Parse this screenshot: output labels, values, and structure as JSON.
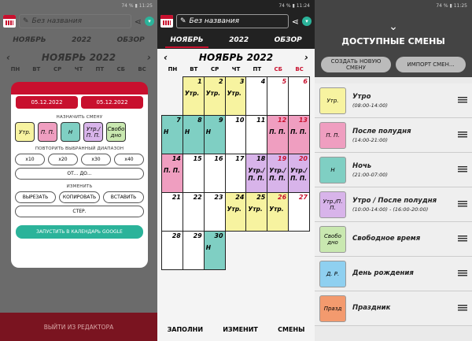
{
  "status": {
    "p1": "74 % ▮ 11:25",
    "p2": "74 % ▮ 11:24",
    "p3": "74 % ▮ 11:25"
  },
  "app": {
    "title": "Без названия"
  },
  "tabs": [
    "НОЯБРЬ",
    "2022",
    "ОБЗОР"
  ],
  "month_title": "НОЯБРЬ 2022",
  "weekdays": [
    "ПН",
    "ВТ",
    "СР",
    "ЧТ",
    "ПТ",
    "СБ",
    "ВС"
  ],
  "calendar": [
    {
      "d": "",
      "l": ""
    },
    {
      "d": "1",
      "l": "Утр."
    },
    {
      "d": "2",
      "l": "Утр."
    },
    {
      "d": "3",
      "l": "Утр."
    },
    {
      "d": "4",
      "l": ""
    },
    {
      "d": "5",
      "l": ""
    },
    {
      "d": "6",
      "l": ""
    },
    {
      "d": "7",
      "l": "Н"
    },
    {
      "d": "8",
      "l": "Н"
    },
    {
      "d": "9",
      "l": "Н"
    },
    {
      "d": "10",
      "l": ""
    },
    {
      "d": "11",
      "l": ""
    },
    {
      "d": "12",
      "l": "П. П."
    },
    {
      "d": "13",
      "l": "П. П."
    },
    {
      "d": "14",
      "l": "П. П."
    },
    {
      "d": "15",
      "l": ""
    },
    {
      "d": "16",
      "l": ""
    },
    {
      "d": "17",
      "l": ""
    },
    {
      "d": "18",
      "l": "Утр./ П. П."
    },
    {
      "d": "19",
      "l": "Утр./ П. П."
    },
    {
      "d": "20",
      "l": "Утр./ П. П."
    },
    {
      "d": "21",
      "l": ""
    },
    {
      "d": "22",
      "l": ""
    },
    {
      "d": "23",
      "l": ""
    },
    {
      "d": "24",
      "l": "Утр."
    },
    {
      "d": "25",
      "l": "Утр."
    },
    {
      "d": "26",
      "l": "Утр."
    },
    {
      "d": "27",
      "l": ""
    },
    {
      "d": "28",
      "l": ""
    },
    {
      "d": "29",
      "l": ""
    },
    {
      "d": "30",
      "l": "Н"
    },
    {
      "d": "",
      "l": ""
    },
    {
      "d": "",
      "l": ""
    },
    {
      "d": "",
      "l": ""
    },
    {
      "d": "",
      "l": ""
    }
  ],
  "calendar_colors": [
    "",
    "#f7f3a0",
    "#f7f3a0",
    "#f7f3a0",
    "",
    "",
    "",
    "#7fcfc3",
    "#7fcfc3",
    "#7fcfc3",
    "",
    "",
    "#ef9ec0",
    "#ef9ec0",
    "#ef9ec0",
    "",
    "",
    "",
    "#d8b4ea",
    "#d8b4ea",
    "#d8b4ea",
    "",
    "",
    "",
    "#f7f3a0",
    "#f7f3a0",
    "#f7f3a0",
    "",
    "",
    "",
    "#7fcfc3",
    "",
    "",
    "",
    "",
    ""
  ],
  "dialog": {
    "from_label": "ОТ",
    "to_label": "ДО",
    "from_date": "05.12.2022",
    "to_date": "05.12.2022",
    "assign_label": "НАЗНАЧИТЬ СМЕНУ",
    "chips": [
      {
        "t": "Утр.",
        "c": "#f7f3a0"
      },
      {
        "t": "П. П.",
        "c": "#ef9ec0"
      },
      {
        "t": "Н",
        "c": "#7fcfc3"
      },
      {
        "t": "Утр./ П. П.",
        "c": "#d8b4ea"
      },
      {
        "t": "Свобо дно",
        "c": "#c9e8b0"
      }
    ],
    "repeat_label": "ПОВТОРИТЬ ВЫБРАННЫЙ ДИАПАЗОН",
    "repeat": [
      "x10",
      "x20",
      "x30",
      "x40"
    ],
    "until": "ОТ... ДО...",
    "change_label": "ИЗМЕНИТЬ",
    "edit": [
      "ВЫРЕЗАТЬ",
      "КОПИРОВАТЬ",
      "ВСТАВИТЬ"
    ],
    "clear": "СТЕР.",
    "google": "ЗАПУСТИТЬ В КАЛЕНДАРЬ GOOGLE"
  },
  "exit": "ВЫЙТИ ИЗ РЕДАКТОРА",
  "bottom": [
    "ЗАПОЛНИ",
    "ИЗМЕНИТ",
    "СМЕНЫ"
  ],
  "shifts_panel": {
    "title": "ДОСТУПНЫЕ СМЕНЫ",
    "create": "СОЗДАТЬ НОВУЮ СМЕНУ",
    "import": "ИМПОРТ СМЕН..."
  },
  "shifts": [
    {
      "abbr": "Утр.",
      "name": "Утро",
      "time": "(08:00-14:00)",
      "color": "#f7f3a0"
    },
    {
      "abbr": "П. П.",
      "name": "После полудня",
      "time": "(14:00-21:00)",
      "color": "#ef9ec0"
    },
    {
      "abbr": "Н",
      "name": "Ночь",
      "time": "(21:00-07:00)",
      "color": "#7fcfc3"
    },
    {
      "abbr": "Утр./П. П.",
      "name": "Утро / После полудня",
      "time": "(10:00-14:00) - (16:00-20:00)",
      "color": "#d8b4ea"
    },
    {
      "abbr": "Свобо дно",
      "name": "Свободное время",
      "time": "",
      "color": "#c9e8b0"
    },
    {
      "abbr": "Д. Р.",
      "name": "День рождения",
      "time": "",
      "color": "#8fd0f0"
    },
    {
      "abbr": "Празд",
      "name": "Праздник",
      "time": "",
      "color": "#f39a6e"
    }
  ]
}
